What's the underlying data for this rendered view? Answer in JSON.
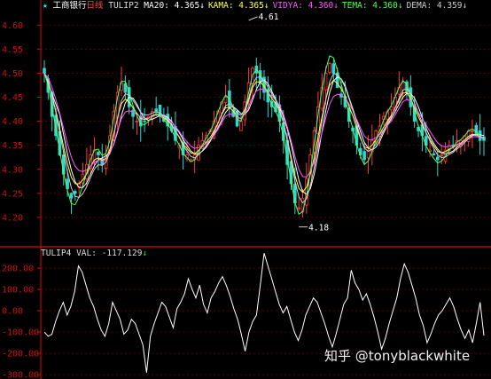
{
  "header": {
    "star": "★",
    "stock_name": "工商银行",
    "period": "日线",
    "indicator": "TULIP2",
    "readouts": [
      {
        "label": "MA20:",
        "value": "4.365",
        "arrow": "↓",
        "color": "#ffffff"
      },
      {
        "label": "KAMA:",
        "value": "4.365",
        "arrow": "↓",
        "color": "#ffff55"
      },
      {
        "label": "VIDYA:",
        "value": "4.360",
        "arrow": "↓",
        "color": "#ff55ff"
      },
      {
        "label": "TEMA:",
        "value": "4.360",
        "arrow": "↓",
        "color": "#55ff55"
      },
      {
        "label": "DEMA:",
        "value": "4.359",
        "arrow": "↓",
        "color": "#cccccc"
      }
    ]
  },
  "subheader": {
    "indicator": "TULIP4",
    "label": "VAL:",
    "value": "-117.129",
    "arrow": "↓"
  },
  "watermark": "知乎 @tonyblackwhite",
  "colors": {
    "up": "#ff3b3b",
    "down": "#2ed8d0",
    "grid": "#8a0000",
    "axis": "#cc1111",
    "ma20": "#ffffff",
    "kama": "#ffff55",
    "vidya": "#ff55ff",
    "tema": "#55ff55",
    "dema": "#cccccc"
  },
  "chart_data": [
    {
      "type": "candlestick",
      "ylim": [
        4.15,
        4.63
      ],
      "yticks": [
        "4.60",
        "4.55",
        "4.50",
        "4.45",
        "4.40",
        "4.35",
        "4.30",
        "4.25",
        "4.20"
      ],
      "annotations": [
        {
          "text": "4.61",
          "kind": "high"
        },
        {
          "text": "4.18",
          "kind": "low"
        }
      ],
      "close": [
        4.5,
        4.46,
        4.41,
        4.37,
        4.33,
        4.29,
        4.26,
        4.24,
        4.25,
        4.27,
        4.29,
        4.31,
        4.33,
        4.34,
        4.33,
        4.31,
        4.33,
        4.37,
        4.42,
        4.46,
        4.48,
        4.46,
        4.43,
        4.41,
        4.4,
        4.39,
        4.4,
        4.41,
        4.42,
        4.42,
        4.41,
        4.4,
        4.39,
        4.38,
        4.36,
        4.35,
        4.33,
        4.33,
        4.32,
        4.33,
        4.35,
        4.36,
        4.37,
        4.38,
        4.4,
        4.42,
        4.44,
        4.45,
        4.43,
        4.41,
        4.39,
        4.4,
        4.44,
        4.48,
        4.51,
        4.5,
        4.48,
        4.46,
        4.44,
        4.43,
        4.42,
        4.4,
        4.36,
        4.31,
        4.27,
        4.23,
        4.22,
        4.24,
        4.28,
        4.33,
        4.38,
        4.43,
        4.47,
        4.5,
        4.52,
        4.5,
        4.47,
        4.45,
        4.43,
        4.4,
        4.38,
        4.35,
        4.33,
        4.32,
        4.34,
        4.36,
        4.38,
        4.39,
        4.41,
        4.42,
        4.43,
        4.45,
        4.47,
        4.48,
        4.46,
        4.43,
        4.4,
        4.38,
        4.37,
        4.35,
        4.34,
        4.33,
        4.32,
        4.33,
        4.34,
        4.35,
        4.35,
        4.36,
        4.36,
        4.37,
        4.38,
        4.38,
        4.37,
        4.36,
        4.36
      ]
    },
    {
      "type": "line",
      "name": "VAL",
      "ylim": [
        -320,
        250
      ],
      "yticks": [
        "200.00",
        "100.00",
        "0.00",
        "-100.00",
        "-200.00",
        "-300.00"
      ],
      "values": [
        -100,
        -120,
        -110,
        -50,
        0,
        40,
        -20,
        20,
        90,
        210,
        180,
        120,
        60,
        20,
        -40,
        -90,
        -120,
        -60,
        40,
        0,
        -40,
        -110,
        -90,
        -40,
        -60,
        -110,
        -160,
        -290,
        -120,
        -60,
        -10,
        40,
        20,
        -30,
        -80,
        10,
        40,
        80,
        150,
        100,
        60,
        120,
        30,
        -10,
        60,
        90,
        130,
        160,
        120,
        70,
        10,
        -40,
        -110,
        -190,
        -100,
        -50,
        -20,
        120,
        270,
        210,
        150,
        90,
        30,
        -10,
        20,
        -40,
        -100,
        -140,
        -90,
        -20,
        20,
        60,
        40,
        -10,
        -60,
        -120,
        -170,
        -110,
        -40,
        30,
        60,
        190,
        130,
        100,
        50,
        80,
        30,
        -30,
        -100,
        -180,
        -130,
        -60,
        0,
        60,
        150,
        220,
        180,
        120,
        60,
        -20,
        -70,
        -150,
        -110,
        -60,
        -20,
        0,
        30,
        60,
        20,
        -40,
        -90,
        -130,
        -90,
        -150,
        -60,
        40,
        -117
      ]
    }
  ]
}
